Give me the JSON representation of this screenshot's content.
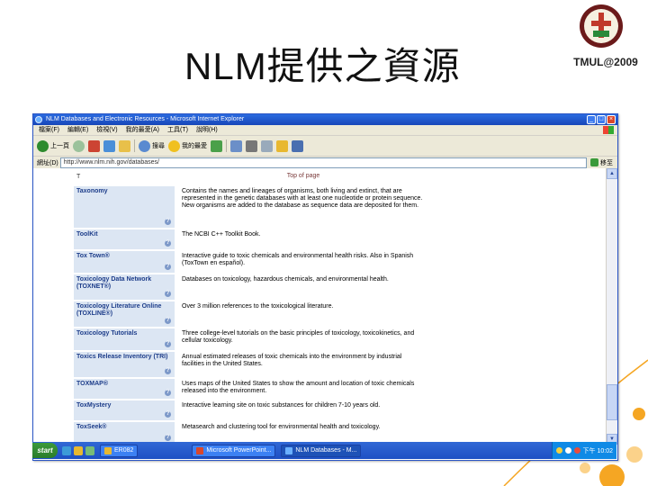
{
  "slide": {
    "title": "NLM提供之資源",
    "logo_caption": "TMUL@2009"
  },
  "browser": {
    "window_title": "NLM Databases and Electronic Resources - Microsoft Internet Explorer",
    "menu": [
      "檔案(F)",
      "編輯(E)",
      "檢視(V)",
      "我的最愛(A)",
      "工具(T)",
      "說明(H)"
    ],
    "toolbar": {
      "back": "上一頁",
      "search": "搜尋",
      "favorites": "我的最愛"
    },
    "address": {
      "label": "網址(D)",
      "value": "http://www.nlm.nih.gov/databases/",
      "go": "移至"
    },
    "page": {
      "header_left": "T",
      "header_right": "Top of page",
      "rows": [
        {
          "name": "Taxonomy",
          "desc": "Contains the names and lineages of organisms, both living and extinct, that are represented in the genetic databases with at least one nucleotide or protein sequence. New organisms are added to the database as sequence data are deposited for them."
        },
        {
          "name": "ToolKit",
          "desc": "The NCBI C++ Toolkit Book."
        },
        {
          "name": "Tox Town®",
          "desc": "Interactive guide to toxic chemicals and environmental health risks. Also in Spanish (ToxTown en español)."
        },
        {
          "name": "Toxicology Data Network (TOXNET®)",
          "desc": "Databases on toxicology, hazardous chemicals, and environmental health."
        },
        {
          "name": "Toxicology Literature Online (TOXLINE®)",
          "desc": "Over 3 million references to the toxicological literature."
        },
        {
          "name": "Toxicology Tutorials",
          "desc": "Three college-level tutorials on the basic principles of toxicology, toxicokinetics, and cellular toxicology."
        },
        {
          "name": "Toxics Release Inventory (TRI)",
          "desc": "Annual estimated releases of toxic chemicals into the environment by industrial facilities in the United States."
        },
        {
          "name": "TOXMAP®",
          "desc": "Uses maps of the United States to show the amount and location of toxic chemicals released into the environment."
        },
        {
          "name": "ToxMystery",
          "desc": "Interactive learning site on toxic substances for children 7-10 years old."
        },
        {
          "name": "ToxSeek®",
          "desc": "Metasearch and clustering tool for environmental health and toxicology."
        }
      ]
    }
  },
  "taskbar": {
    "start": "start",
    "tasks": [
      "ER082",
      "Microsoft PowerPoint...",
      "NLM Databases - M..."
    ],
    "clock": "下午 10:02"
  },
  "colors": {
    "accent_circle": "#f5a623",
    "titlebar": "#1c57d4",
    "row_bg": "#dce6f3",
    "link": "#1d3d8a"
  }
}
